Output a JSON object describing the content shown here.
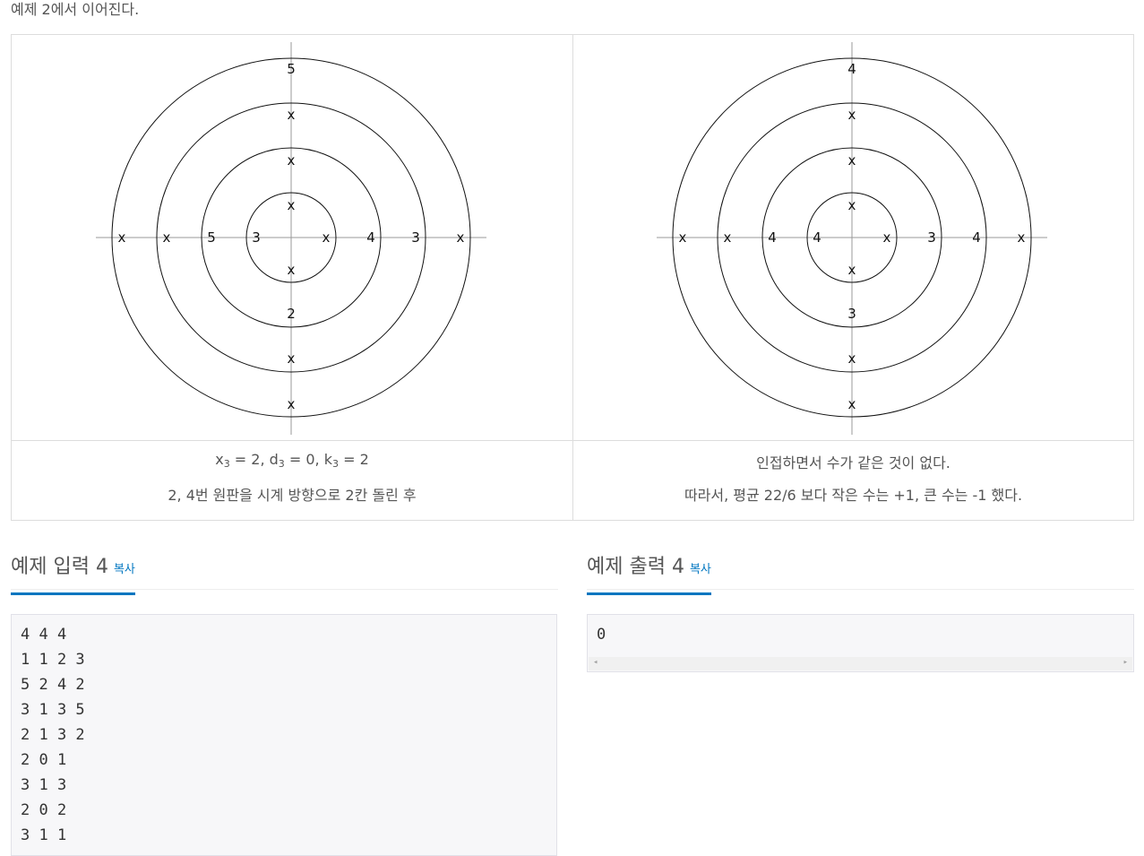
{
  "intro_text": "예제 2에서 이어진다.",
  "figures": [
    {
      "labels": {
        "up": [
          "x",
          "x",
          "x",
          "5",
          "x"
        ],
        "down": [
          "x",
          "2",
          "x",
          "x"
        ],
        "left": [
          "3",
          "5",
          "x",
          "x"
        ],
        "right": [
          "x",
          "4",
          "3",
          "x"
        ]
      },
      "caption_line2": "2, 4번 원판을 시계 방향으로 2칸 돌린 후"
    },
    {
      "labels": {
        "up": [
          "x",
          "x",
          "x",
          "4",
          "x"
        ],
        "down": [
          "x",
          "3",
          "x",
          "x"
        ],
        "left": [
          "4",
          "4",
          "x",
          "x"
        ],
        "right": [
          "x",
          "3",
          "4",
          "x"
        ]
      },
      "caption_line1": "인접하면서 수가 같은 것이 없다.",
      "caption_line2": "따라서, 평균 22/6 보다 작은 수는 +1, 큰 수는 -1 했다."
    }
  ],
  "caption_formula": {
    "x_var": "x",
    "x_sub": "3",
    "x_val": " = 2, ",
    "d_var": "d",
    "d_sub": "3",
    "d_val": " = 0, ",
    "k_var": "k",
    "k_sub": "3",
    "k_val": " = 2"
  },
  "input_section": {
    "title": "예제 입력 4",
    "copy_label": "복사",
    "lines": [
      "4 4 4",
      "1 1 2 3",
      "5 2 4 2",
      "3 1 3 5",
      "2 1 3 2",
      "2 0 1",
      "3 1 3",
      "2 0 2",
      "3 1 1"
    ]
  },
  "output_section": {
    "title": "예제 출력 4",
    "copy_label": "복사",
    "lines": [
      "0"
    ]
  },
  "scroll_arrows": {
    "left": "◂",
    "right": "▸"
  }
}
